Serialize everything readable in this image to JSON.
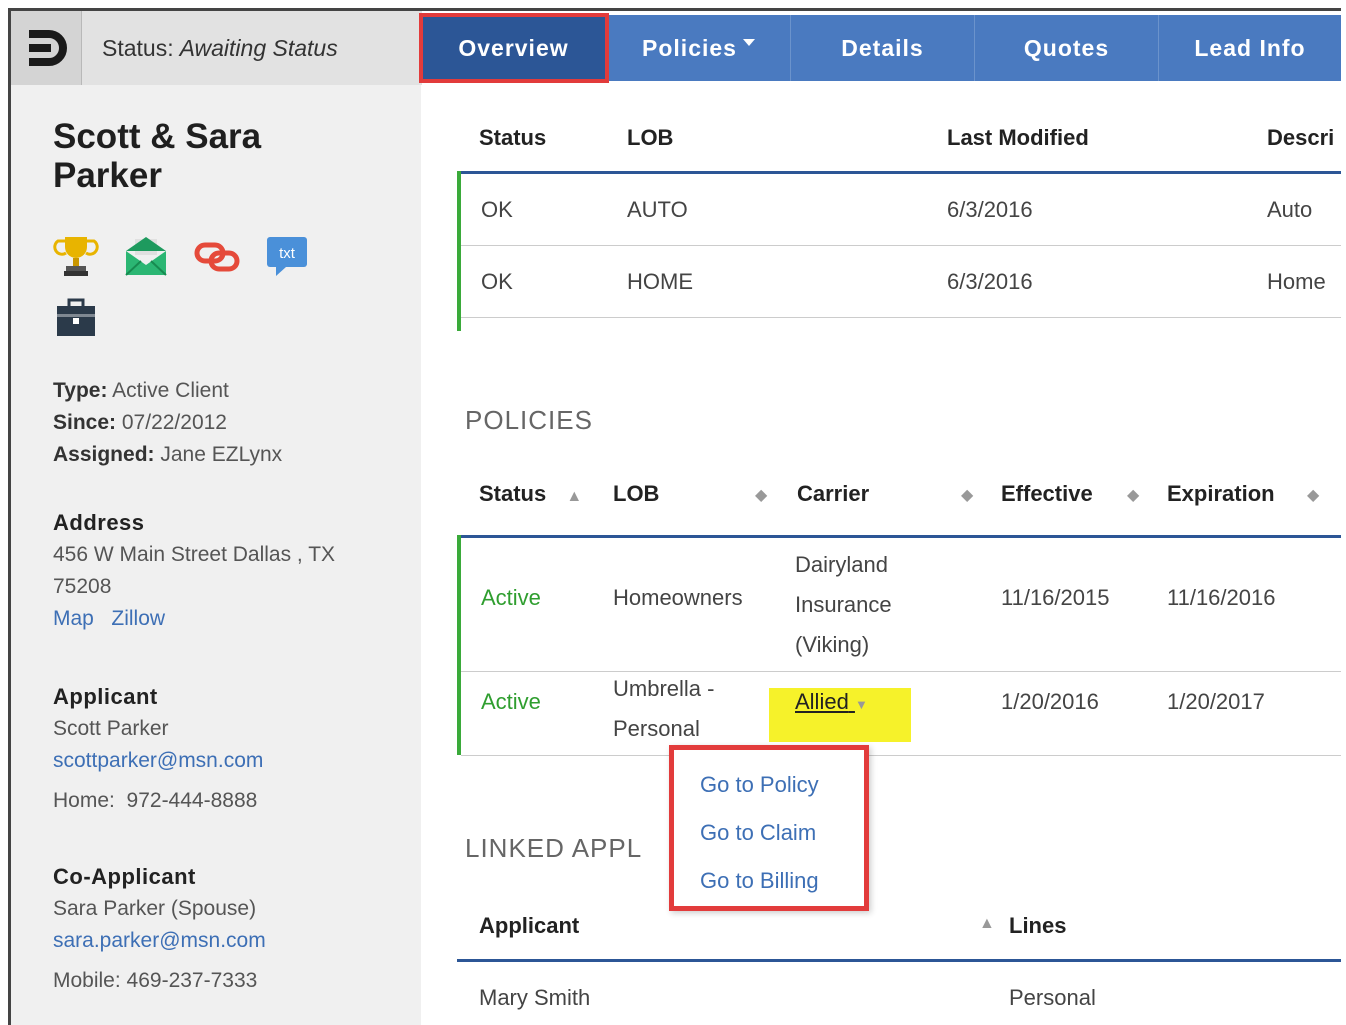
{
  "topbar": {
    "status_label": "Status:",
    "status_value": "Awaiting Status",
    "tabs": [
      {
        "label": "Overview"
      },
      {
        "label": "Policies"
      },
      {
        "label": "Details"
      },
      {
        "label": "Quotes"
      },
      {
        "label": "Lead Info"
      }
    ]
  },
  "client": {
    "name_line1": "Scott & Sara",
    "name_line2": "Parker",
    "icons": [
      "trophy-icon",
      "mail-icon",
      "link-icon",
      "txt-icon",
      "briefcase-icon"
    ],
    "icon_txt": "txt",
    "type_label": "Type:",
    "type_value": "Active Client",
    "since_label": "Since:",
    "since_value": "07/22/2012",
    "assigned_label": "Assigned:",
    "assigned_value": "Jane EZLynx",
    "address_heading": "Address",
    "address_line1": "456 W Main Street Dallas , TX",
    "address_line2": "75208",
    "map_link": "Map",
    "zillow_link": "Zillow",
    "applicant_heading": "Applicant",
    "applicant_name": "Scott Parker",
    "applicant_email": "scottparker@msn.com",
    "applicant_phone_label": "Home:",
    "applicant_phone": "972-444-8888",
    "coapplicant_heading": "Co-Applicant",
    "coapplicant_name": "Sara Parker (Spouse)",
    "coapplicant_email": "sara.parker@msn.com",
    "coapplicant_phone_label": "Mobile:",
    "coapplicant_phone": "469-237-7333"
  },
  "status_table": {
    "headers": [
      "Status",
      "LOB",
      "Last Modified",
      "Descri"
    ],
    "rows": [
      [
        "OK",
        "AUTO",
        "6/3/2016",
        "Auto"
      ],
      [
        "OK",
        "HOME",
        "6/3/2016",
        "Home"
      ]
    ]
  },
  "policies": {
    "title": "POLICIES",
    "headers": [
      "Status",
      "LOB",
      "Carrier",
      "Effective",
      "Expiration"
    ],
    "rows": [
      {
        "status": "Active",
        "lob": "Homeowners",
        "carrier_l1": "Dairyland",
        "carrier_l2": "Insurance",
        "carrier_l3": "(Viking)",
        "effective": "11/16/2015",
        "expiration": "11/16/2016"
      },
      {
        "status": "Active",
        "lob_l1": "Umbrella -",
        "lob_l2": "Personal",
        "carrier": "Allied",
        "effective": "1/20/2016",
        "expiration": "1/20/2017"
      }
    ],
    "menu": [
      "Go to Policy",
      "Go to Claim",
      "Go to Billing"
    ]
  },
  "linked": {
    "title": "LINKED APPL",
    "headers": [
      "Applicant",
      "Lines"
    ],
    "rows": [
      [
        "Mary Smith",
        "Personal"
      ]
    ]
  },
  "colors": {
    "tab_blue": "#4a7ac0",
    "tab_active": "#2c5696",
    "highlight_red": "#e23b3b",
    "active_green": "#2f9e2f",
    "link_blue": "#3d6fb5"
  }
}
